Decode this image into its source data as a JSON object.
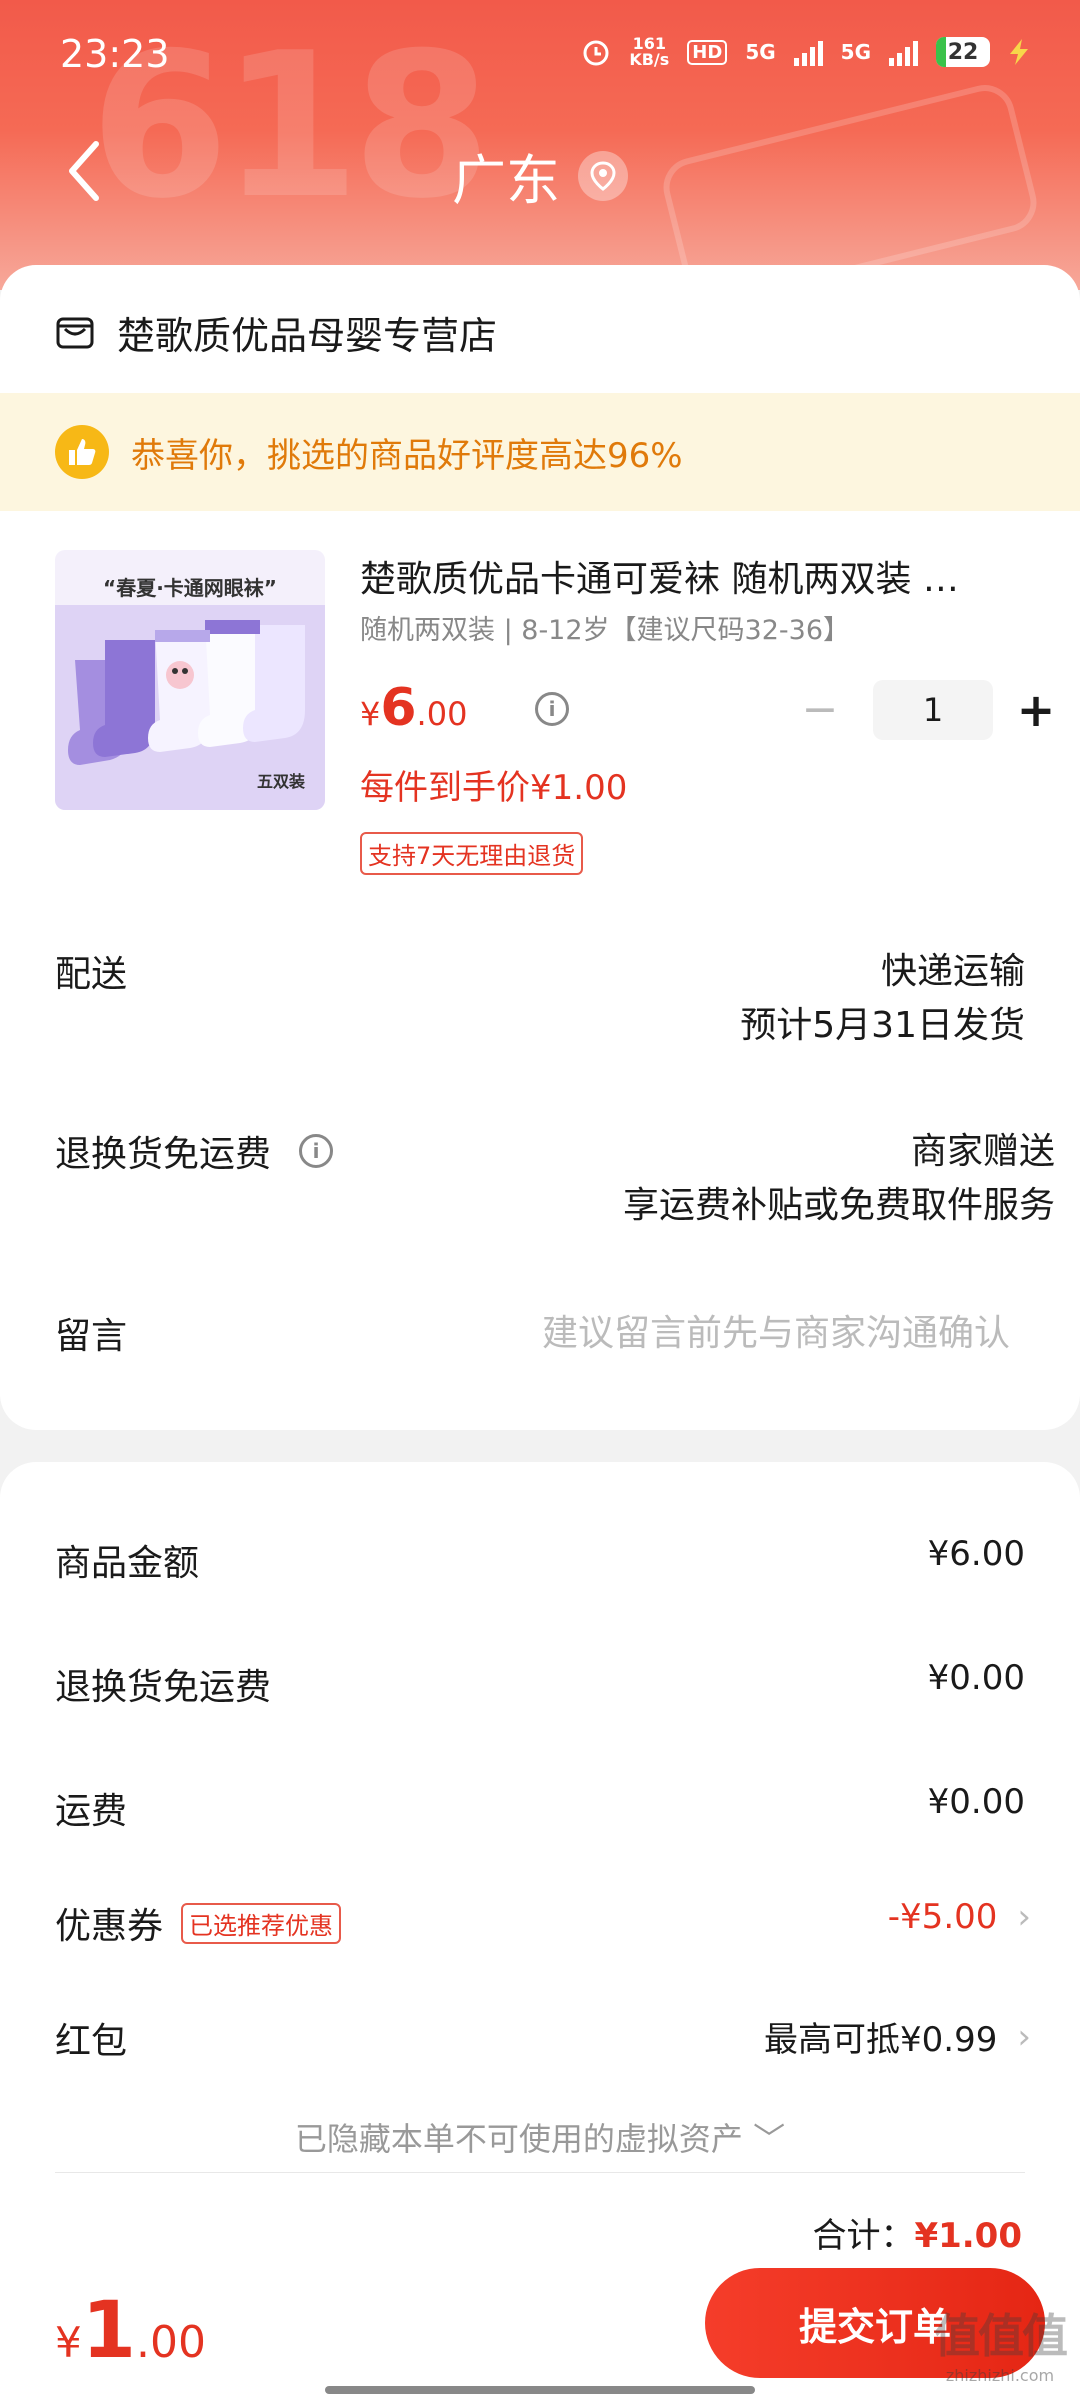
{
  "status_bar": {
    "time": "23:23",
    "net_speed_value": "161",
    "net_speed_unit": "KB/s",
    "hd": "HD",
    "sim1": "5G",
    "sim2": "5G",
    "battery": "22"
  },
  "header": {
    "bg_text": "618",
    "title": "广东"
  },
  "store": {
    "name": "楚歌质优品母婴专营店"
  },
  "banner": {
    "text": "恭喜你，挑选的商品好评度高达96%"
  },
  "product": {
    "image_caption": "“春夏·卡通网眼袜”",
    "image_sub": "五双装",
    "title": "楚歌质优品卡通可爱袜 随机两双装 …",
    "spec": "随机两双装 | 8-12岁【建议尺码32-36】",
    "price_yen": "¥",
    "price_int": "6",
    "price_dec": ".00",
    "quantity": "1",
    "minus": "−",
    "plus": "+",
    "per_piece": "每件到手价¥1.00",
    "return_tag": "支持7天无理由退货"
  },
  "delivery": {
    "label": "配送",
    "method": "快递运输",
    "estimate": "预计5月31日发货"
  },
  "return_shipping": {
    "label": "退换货免运费",
    "value": "商家赠送",
    "desc": "享运费补贴或免费取件服务"
  },
  "message": {
    "label": "留言",
    "placeholder": "建议留言前先与商家沟通确认"
  },
  "summary": {
    "goods_label": "商品金额",
    "goods_amount": "¥6.00",
    "return_label": "退换货免运费",
    "return_amount": "¥0.00",
    "shipping_label": "运费",
    "shipping_amount": "¥0.00",
    "coupon_label": "优惠券",
    "coupon_tag": "已选推荐优惠",
    "coupon_amount": "-¥5.00",
    "redpacket_label": "红包",
    "redpacket_amount": "最高可抵¥0.99",
    "hidden_assets": "已隐藏本单不可使用的虚拟资产 ﹀",
    "total_label": "合计：",
    "total_amount": "¥1.00"
  },
  "bottom_bar": {
    "pay_yen": "¥",
    "pay_int": "1",
    "pay_dec": ".00",
    "submit_label": "提交订单",
    "watermark": "值值值",
    "watermark_url": "zhizhizhi.com"
  },
  "colors": {
    "accent": "#e43321",
    "header_top": "#f25a4a",
    "banner_bg": "#fdf6df",
    "banner_text": "#e07a0a"
  }
}
